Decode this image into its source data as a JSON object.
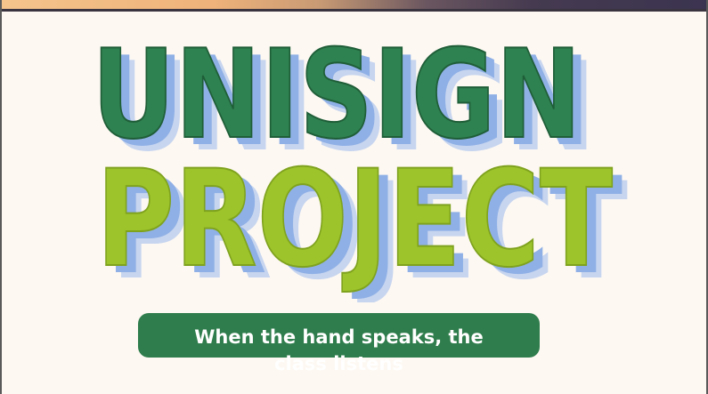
{
  "title": {
    "line1": "UNISIGN",
    "line2": "PROJECT"
  },
  "tagline": "When the hand speaks, the class listens",
  "colors": {
    "line1_fill": "#2e8150",
    "line2_fill": "#9dc42a",
    "shadow": "#8fb0e6",
    "shadow_light": "#c7d5ef",
    "tagline_bg": "#2f7d4c",
    "background": "#fdf8f2"
  }
}
